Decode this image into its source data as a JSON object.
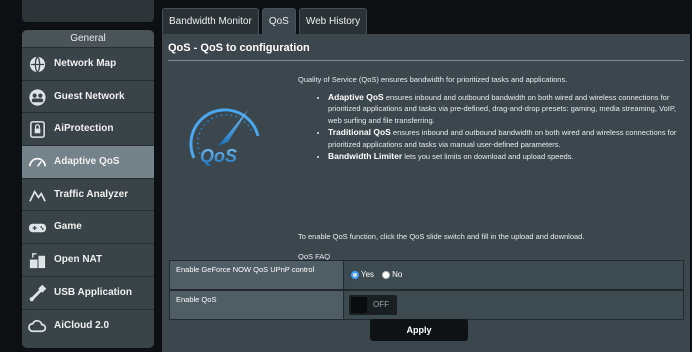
{
  "sidebar": {
    "header": "General",
    "items": [
      {
        "label": "Network Map",
        "icon": "globe-icon"
      },
      {
        "label": "Guest Network",
        "icon": "guest-icon"
      },
      {
        "label": "AiProtection",
        "icon": "lock-icon"
      },
      {
        "label": "Adaptive QoS",
        "icon": "speedometer-icon",
        "active": true
      },
      {
        "label": "Traffic Analyzer",
        "icon": "analyzer-icon"
      },
      {
        "label": "Game",
        "icon": "gamepad-icon"
      },
      {
        "label": "Open NAT",
        "icon": "open-nat-icon"
      },
      {
        "label": "USB Application",
        "icon": "usb-icon"
      },
      {
        "label": "AiCloud 2.0",
        "icon": "cloud-icon"
      }
    ]
  },
  "tabs": [
    {
      "label": "Bandwidth Monitor",
      "active": false
    },
    {
      "label": "QoS",
      "active": true
    },
    {
      "label": "Web History",
      "active": false
    }
  ],
  "panel": {
    "title": "QoS - QoS to configuration",
    "intro": "Quality of Service (QoS) ensures bandwidth for prioritized tasks and applications.",
    "bullets": [
      {
        "term": "Adaptive QoS",
        "text": " ensures inbound and outbound bandwidth on both wired and wireless connections for prioritized applications and tasks via pre-defined, drag-and-drop presets: gaming, media streaming, VoIP, web surfing and file transferring."
      },
      {
        "term": "Traditional QoS",
        "text": " ensures inbound and outbound bandwidth on both wired and wireless connections for prioritized applications and tasks via manual user-defined parameters."
      },
      {
        "term": "Bandwidth Limiter",
        "text": " lets you set limits on download and upload speeds."
      }
    ],
    "enable_text": "To enable QoS function, click the QoS slide switch and fill in the upload and download.",
    "faq_link": "QoS FAQ",
    "logo_text": "QoS"
  },
  "settings": {
    "geforce_label": "Enable GeForce NOW QoS UPnP control",
    "geforce_yes": "Yes",
    "geforce_no": "No",
    "enable_qos_label": "Enable QoS",
    "enable_qos_state": "OFF"
  },
  "apply_label": "Apply",
  "colors": {
    "accent": "#3da0ff",
    "panel": "#3b474c",
    "active_item": "#74828a"
  }
}
